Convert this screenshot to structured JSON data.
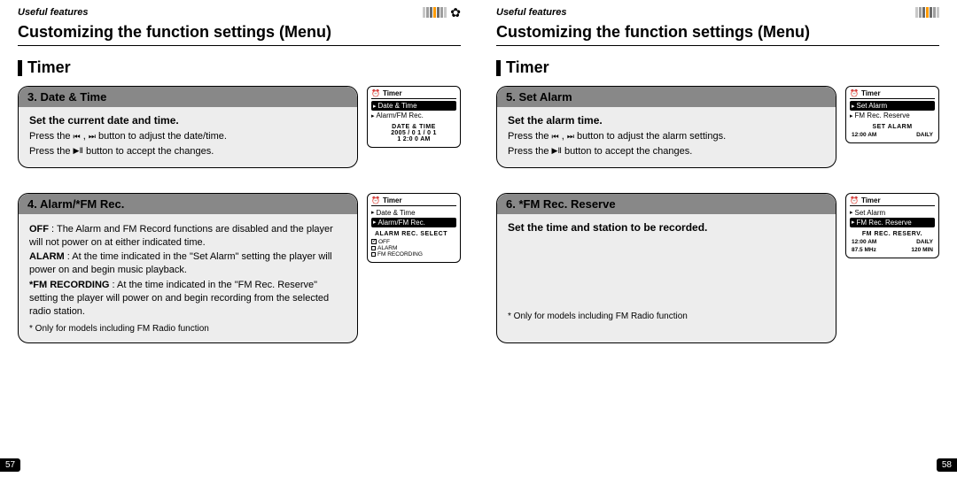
{
  "stripes_colors": [
    "#c8c8c8",
    "#9e9e9e",
    "#6b6b6b",
    "#ff9a00",
    "#6b6b6b",
    "#9e9e9e",
    "#c8c8c8"
  ],
  "left": {
    "breadcrumb": "Useful features",
    "chapter": "Customizing the function settings (Menu)",
    "section": "Timer",
    "page_num": "57",
    "block1": {
      "heading": "3. Date & Time",
      "sub": "Set the current date and time.",
      "line1a": "Press the ",
      "line1b": " , ",
      "line1c": " button to adjust the date/time.",
      "line2a": "Press the ",
      "line2b": " button to accept the changes.",
      "lcd": {
        "title": "Timer",
        "row1": "Date & Time",
        "row2": "Alarm/FM Rec.",
        "sub": "DATE & TIME",
        "data1": "2005 / 0 1 / 0 1",
        "data2": "1 2:0 0  AM"
      }
    },
    "block2": {
      "heading": "4. Alarm/*FM Rec.",
      "l_off": "OFF",
      "t_off": " : The Alarm and FM Record functions are disabled and the player will not power on at either indicated time.",
      "l_alarm": "ALARM",
      "t_alarm": " : At the time indicated in the \"Set Alarm\" setting the player will power on and begin music playback.",
      "l_fm": "*FM RECORDING",
      "t_fm": " : At the time indicated in the \"FM Rec. Reserve\" setting the player will power on and begin recording from the selected radio station.",
      "foot": "* Only for models including FM Radio function",
      "lcd": {
        "title": "Timer",
        "row1": "Date & Time",
        "row2": "Alarm/FM Rec.",
        "sub": "ALARM REC. SELECT",
        "o1": "OFF",
        "o2": "ALARM",
        "o3": "FM RECORDING"
      }
    }
  },
  "right": {
    "breadcrumb": "Useful features",
    "chapter": "Customizing the function settings (Menu)",
    "section": "Timer",
    "page_num": "58",
    "block1": {
      "heading": "5. Set Alarm",
      "sub": "Set the alarm time.",
      "line1a": "Press the ",
      "line1b": " , ",
      "line1c": " button to adjust the alarm settings.",
      "line2a": "Press the ",
      "line2b": " button to accept the changes.",
      "lcd": {
        "title": "Timer",
        "row1": "Set Alarm",
        "row2": "FM Rec. Reserve",
        "sub": "SET ALARM",
        "c1": "12:00 AM",
        "c2": "DAILY"
      }
    },
    "block2": {
      "heading": "6. *FM Rec. Reserve",
      "sub": "Set the time and station to be recorded.",
      "foot": "* Only for models including FM Radio function",
      "lcd": {
        "title": "Timer",
        "row1": "Set Alarm",
        "row2": "FM Rec. Reserve",
        "sub": "FM REC. RESERV.",
        "r1c1": "12:00 AM",
        "r1c2": "DAILY",
        "r2c1": "87.5 MHz",
        "r2c2": "120 MIN"
      }
    }
  }
}
